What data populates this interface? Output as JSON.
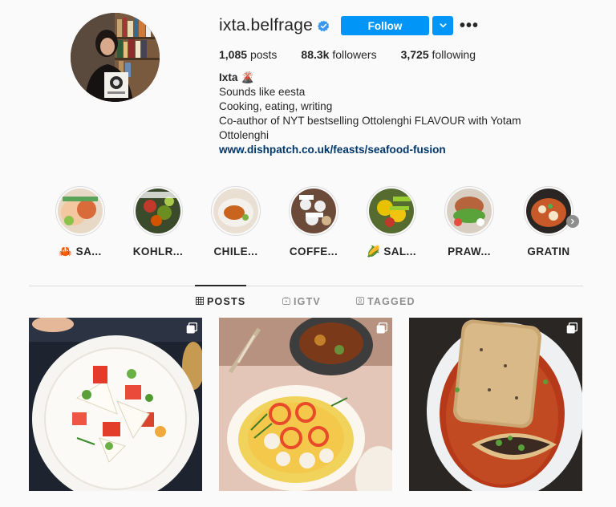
{
  "profile": {
    "username": "ixta.belfrage",
    "follow_label": "Follow",
    "more_label": "•••",
    "stats": {
      "posts_count": "1,085",
      "posts_label": "posts",
      "followers_count": "88.3k",
      "followers_label": "followers",
      "following_count": "3,725",
      "following_label": "following"
    },
    "bio": {
      "name": "Ixta",
      "name_emoji": "🌋",
      "lines": [
        "Sounds like eesta",
        "Cooking, eating, writing",
        "Co-author of NYT bestselling Ottolenghi FLAVOUR with Yotam Ottolenghi"
      ],
      "link": "www.dishpatch.co.uk/feasts/seafood-fusion"
    }
  },
  "highlights": [
    {
      "label": "🦀 SA...",
      "icon": "crab-emoji"
    },
    {
      "label": "KOHLR..."
    },
    {
      "label": "CHILE..."
    },
    {
      "label": "COFFE..."
    },
    {
      "label": "🌽 SAL...",
      "icon": "corn-emoji"
    },
    {
      "label": "PRAW..."
    },
    {
      "label": "GRATIN"
    }
  ],
  "tabs": [
    {
      "label": "POSTS",
      "icon": "grid-icon",
      "active": true
    },
    {
      "label": "IGTV",
      "icon": "igtv-icon",
      "active": false
    },
    {
      "label": "TAGGED",
      "icon": "tagged-icon",
      "active": false
    }
  ],
  "posts": [
    {
      "type": "multiple",
      "icon": "carousel-icon"
    },
    {
      "type": "multiple",
      "icon": "carousel-icon"
    },
    {
      "type": "multiple",
      "icon": "carousel-icon"
    }
  ],
  "colors": {
    "accent": "#0095f6",
    "link": "#00376b",
    "text": "#262626",
    "muted": "#8e8e8e",
    "border": "#dbdbdb",
    "background": "#fafafa"
  }
}
